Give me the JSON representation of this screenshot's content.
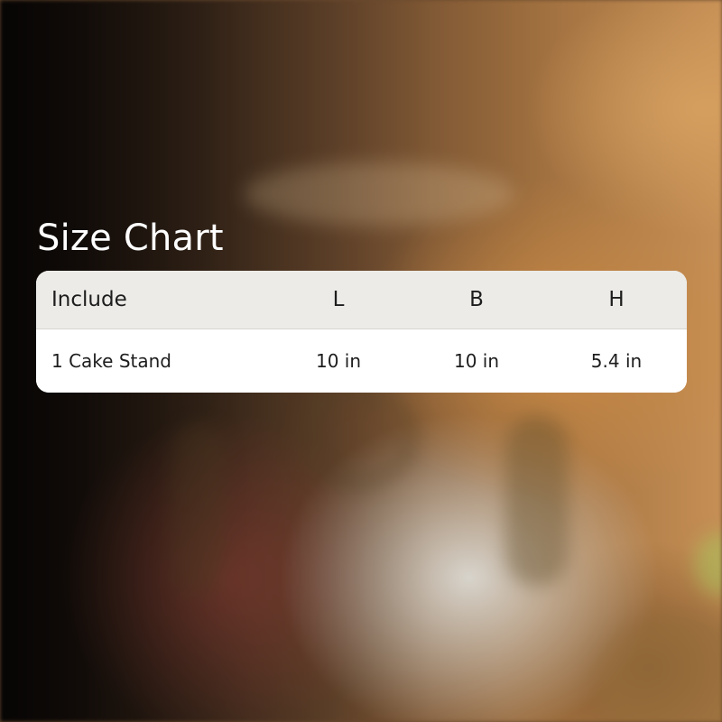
{
  "title": "Size Chart",
  "table": {
    "headers": [
      "Include",
      "L",
      "B",
      "H"
    ],
    "rows": [
      [
        "1 Cake Stand",
        "10 in",
        "10 in",
        "5.4 in"
      ]
    ]
  }
}
